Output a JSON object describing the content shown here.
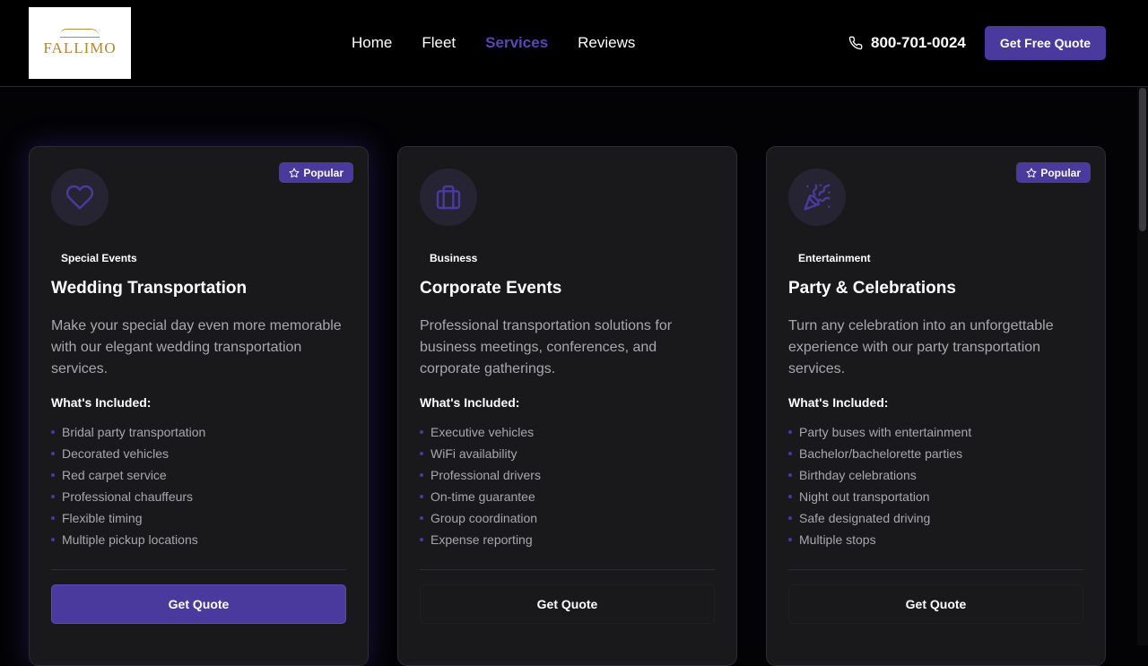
{
  "header": {
    "logo_text": "FALLIMO",
    "nav": [
      {
        "label": "Home"
      },
      {
        "label": "Fleet"
      },
      {
        "label": "Services",
        "active": true
      },
      {
        "label": "Reviews"
      }
    ],
    "phone": "800-701-0024",
    "cta_label": "Get Free Quote"
  },
  "colors": {
    "accent": "#4b3a9e",
    "active_nav": "#5b45b8",
    "card_bg": "#19191c",
    "page_bg": "#030305"
  },
  "cards": [
    {
      "badge": "Popular",
      "icon": "heart-icon",
      "category": "Special Events",
      "title": "Wedding Transportation",
      "description": "Make your special day even more memorable with our elegant wedding transportation services.",
      "included_label": "What's Included:",
      "features": [
        "Bridal party transportation",
        "Decorated vehicles",
        "Red carpet service",
        "Professional chauffeurs",
        "Flexible timing",
        "Multiple pickup locations"
      ],
      "button_label": "Get Quote",
      "button_style": "primary"
    },
    {
      "badge": "",
      "icon": "briefcase-icon",
      "category": "Business",
      "title": "Corporate Events",
      "description": "Professional transportation solutions for business meetings, conferences, and corporate gatherings.",
      "included_label": "What's Included:",
      "features": [
        "Executive vehicles",
        "WiFi availability",
        "Professional drivers",
        "On-time guarantee",
        "Group coordination",
        "Expense reporting"
      ],
      "button_label": "Get Quote",
      "button_style": "ghost"
    },
    {
      "badge": "Popular",
      "icon": "party-popper-icon",
      "category": "Entertainment",
      "title": "Party & Celebrations",
      "description": "Turn any celebration into an unforgettable experience with our party transportation services.",
      "included_label": "What's Included:",
      "features": [
        "Party buses with entertainment",
        "Bachelor/bachelorette parties",
        "Birthday celebrations",
        "Night out transportation",
        "Safe designated driving",
        "Multiple stops"
      ],
      "button_label": "Get Quote",
      "button_style": "ghost"
    }
  ]
}
